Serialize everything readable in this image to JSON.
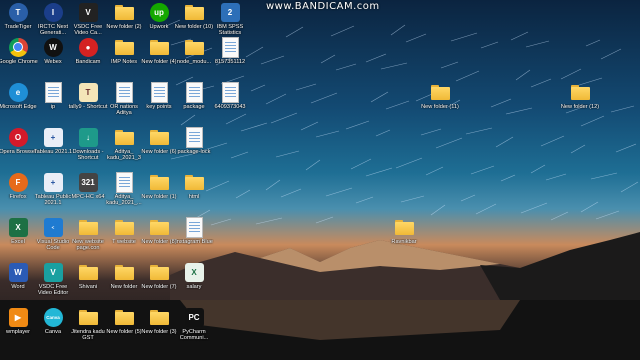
{
  "watermark": "www.BANDICAM.com",
  "icons": [
    {
      "label": "TradeTiger",
      "type": "circle",
      "color": "#2a5fa8",
      "text": "T"
    },
    {
      "label": "IRCTC Next Generati...",
      "type": "circle",
      "color": "#1b3e8a",
      "text": "I"
    },
    {
      "label": "VSDC Free Video Ca...",
      "type": "square",
      "color": "#222",
      "text": "V"
    },
    {
      "label": "New folder (2)",
      "type": "folder"
    },
    {
      "label": "Upwork",
      "type": "circle",
      "color": "#14a800",
      "text": "up"
    },
    {
      "label": "New folder (10)",
      "type": "folder"
    },
    {
      "label": "IBM SPSS Statistics",
      "type": "square",
      "color": "#2d6fb8",
      "text": "2"
    },
    {
      "label": "Google Chrome",
      "type": "chrome"
    },
    {
      "label": "Webex",
      "type": "circle",
      "color": "#111",
      "text": "W"
    },
    {
      "label": "Bandicam",
      "type": "circle",
      "color": "#d42222",
      "text": "●"
    },
    {
      "label": "IMP Notes",
      "type": "folder"
    },
    {
      "label": "New folder (4)",
      "type": "folder"
    },
    {
      "label": "node_modu...",
      "type": "folder"
    },
    {
      "label": "8157351112",
      "type": "doc"
    },
    {
      "label": "Microsoft Edge",
      "type": "circle",
      "color": "#1f8fd6",
      "text": "e"
    },
    {
      "label": "ip",
      "type": "doc"
    },
    {
      "label": "tally9 - Shortcut",
      "type": "square",
      "color": "#f4e5b8",
      "text": "T",
      "fg": "#6b2b2b"
    },
    {
      "label": "OR nations Aditya",
      "type": "doc"
    },
    {
      "label": "key points",
      "type": "doc"
    },
    {
      "label": "package",
      "type": "doc"
    },
    {
      "label": "6409373043",
      "type": "doc"
    },
    {
      "label": "New folder (11)",
      "type": "folder"
    },
    {
      "label": "New folder (12)",
      "type": "folder"
    },
    {
      "label": "Opera Browser",
      "type": "circle",
      "color": "#d31a2a",
      "text": "O"
    },
    {
      "label": "Tableau 2021.1",
      "type": "square",
      "color": "#e9eef7",
      "text": "+",
      "fg": "#1f4e9c"
    },
    {
      "label": "Downloads - Shortcut",
      "type": "square",
      "color": "#1e9a8a",
      "text": "↓"
    },
    {
      "label": "Aditya_ kadu_2021_3",
      "type": "folder"
    },
    {
      "label": "New folder (6)",
      "type": "folder"
    },
    {
      "label": "package-lock",
      "type": "doc"
    },
    {
      "label": "Firefox",
      "type": "circle",
      "color": "#e66a1b",
      "text": "F"
    },
    {
      "label": "Tableau Public 2021.1",
      "type": "square",
      "color": "#e9eef7",
      "text": "+",
      "fg": "#1f4e9c"
    },
    {
      "label": "MPC-HC x64",
      "type": "square",
      "color": "#444",
      "text": "321"
    },
    {
      "label": "Aditya_ kadu_2021_...",
      "type": "doc"
    },
    {
      "label": "New folder (1)",
      "type": "folder"
    },
    {
      "label": "html",
      "type": "folder"
    },
    {
      "label": "Excel",
      "type": "square",
      "color": "#1d7044",
      "text": "X"
    },
    {
      "label": "Visual Studio Code",
      "type": "square",
      "color": "#1f7bd1",
      "text": "&lt;"
    },
    {
      "label": "New website page.con",
      "type": "folder"
    },
    {
      "label": "T website",
      "type": "folder"
    },
    {
      "label": "New folder (8)",
      "type": "folder"
    },
    {
      "label": "Instagram Blue",
      "type": "doc"
    },
    {
      "label": "Ravnikbar",
      "type": "folder"
    },
    {
      "label": "Word",
      "type": "square",
      "color": "#2b5bb5",
      "text": "W"
    },
    {
      "label": "VSDC Free Video Editor",
      "type": "square",
      "color": "#1aa0a0",
      "text": "V"
    },
    {
      "label": "Shivani",
      "type": "folder"
    },
    {
      "label": "New folder",
      "type": "folder"
    },
    {
      "label": "New folder (7)",
      "type": "folder"
    },
    {
      "label": "salary",
      "type": "square",
      "color": "#e8f2ea",
      "text": "X",
      "fg": "#1d7044"
    },
    {
      "label": "wmplayer",
      "type": "square",
      "color": "#f08a14",
      "text": "▶"
    },
    {
      "label": "Canva",
      "type": "circle",
      "color": "#22b7d6",
      "text": "Canva"
    },
    {
      "label": "Jitendra kadu GST",
      "type": "folder"
    },
    {
      "label": "New folder (5)",
      "type": "folder"
    },
    {
      "label": "New folder (3)",
      "type": "folder"
    },
    {
      "label": "PyCharm Communi...",
      "type": "square",
      "color": "#111",
      "text": "PC"
    }
  ]
}
